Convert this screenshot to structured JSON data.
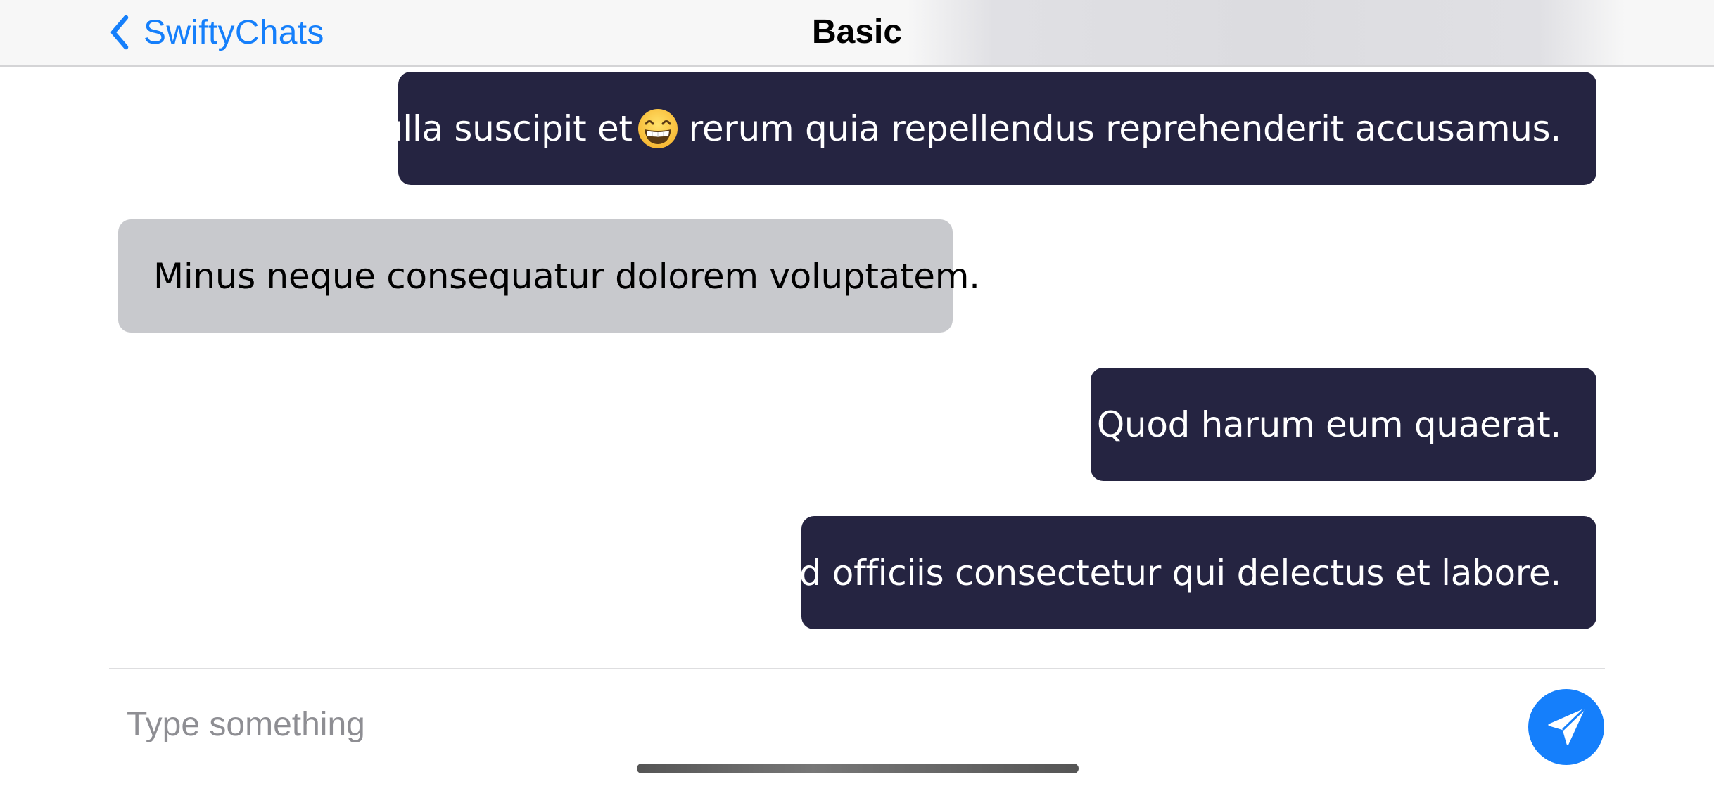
{
  "navbar": {
    "back_label": "SwiftyChats",
    "back_icon": "chevron-left-icon",
    "title": "Basic"
  },
  "messages": [
    {
      "direction": "outgoing",
      "text_before_emoji": "Nulla suscipit et",
      "emoji": "grinning-face-with-smiling-eyes",
      "text_after_emoji": "rerum quia repellendus reprehenderit accusamus."
    },
    {
      "direction": "incoming",
      "text": "Minus neque consequatur dolorem voluptatem."
    },
    {
      "direction": "outgoing",
      "text": "Quod harum eum quaerat."
    },
    {
      "direction": "outgoing",
      "text": "Ad officiis consectetur qui delectus et labore."
    }
  ],
  "composer": {
    "placeholder": "Type something",
    "value": "",
    "send_icon": "paper-plane-icon"
  },
  "colors": {
    "accent": "#157ffb",
    "outgoing_bubble": "#252441",
    "incoming_bubble": "#c8c9cd",
    "navbar_background": "#f7f7f7"
  }
}
